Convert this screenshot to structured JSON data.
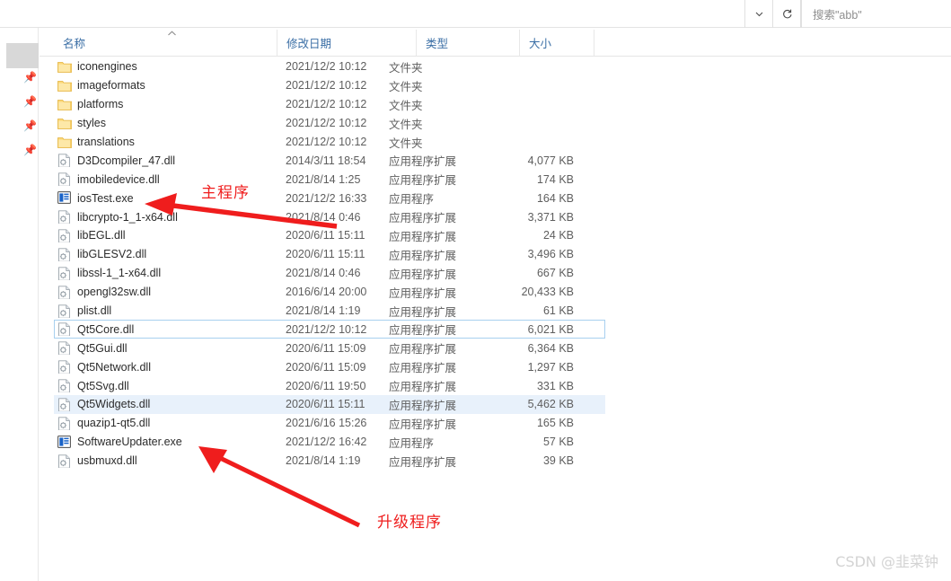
{
  "topbar": {
    "history_dropdown_icon": "chevron-down-icon",
    "refresh_icon": "refresh-icon",
    "search_placeholder": "搜索\"abb\""
  },
  "left_rail": {
    "pin_icon": "pin-icon",
    "pin_count": 4
  },
  "columns": [
    {
      "key": "name",
      "label": "名称",
      "sort": "asc",
      "sort_caret": "⌃"
    },
    {
      "key": "date",
      "label": "修改日期",
      "sort": "none"
    },
    {
      "key": "type",
      "label": "类型",
      "sort": "none"
    },
    {
      "key": "size",
      "label": "大小",
      "sort": "none"
    }
  ],
  "files": [
    {
      "icon": "folder-icon",
      "name": "iconengines",
      "date": "2021/12/2 10:12",
      "type": "文件夹",
      "size": "",
      "state": "normal"
    },
    {
      "icon": "folder-icon",
      "name": "imageformats",
      "date": "2021/12/2 10:12",
      "type": "文件夹",
      "size": "",
      "state": "normal"
    },
    {
      "icon": "folder-icon",
      "name": "platforms",
      "date": "2021/12/2 10:12",
      "type": "文件夹",
      "size": "",
      "state": "normal"
    },
    {
      "icon": "folder-icon",
      "name": "styles",
      "date": "2021/12/2 10:12",
      "type": "文件夹",
      "size": "",
      "state": "normal"
    },
    {
      "icon": "folder-icon",
      "name": "translations",
      "date": "2021/12/2 10:12",
      "type": "文件夹",
      "size": "",
      "state": "normal"
    },
    {
      "icon": "dll-icon",
      "name": "D3Dcompiler_47.dll",
      "date": "2014/3/11 18:54",
      "type": "应用程序扩展",
      "size": "4,077 KB",
      "state": "normal"
    },
    {
      "icon": "dll-icon",
      "name": "imobiledevice.dll",
      "date": "2021/8/14 1:25",
      "type": "应用程序扩展",
      "size": "174 KB",
      "state": "normal"
    },
    {
      "icon": "application-icon",
      "name": "iosTest.exe",
      "date": "2021/12/2 16:33",
      "type": "应用程序",
      "size": "164 KB",
      "state": "normal"
    },
    {
      "icon": "dll-icon",
      "name": "libcrypto-1_1-x64.dll",
      "date": "2021/8/14 0:46",
      "type": "应用程序扩展",
      "size": "3,371 KB",
      "state": "normal"
    },
    {
      "icon": "dll-icon",
      "name": "libEGL.dll",
      "date": "2020/6/11 15:11",
      "type": "应用程序扩展",
      "size": "24 KB",
      "state": "normal"
    },
    {
      "icon": "dll-icon",
      "name": "libGLESV2.dll",
      "date": "2020/6/11 15:11",
      "type": "应用程序扩展",
      "size": "3,496 KB",
      "state": "normal"
    },
    {
      "icon": "dll-icon",
      "name": "libssl-1_1-x64.dll",
      "date": "2021/8/14 0:46",
      "type": "应用程序扩展",
      "size": "667 KB",
      "state": "normal"
    },
    {
      "icon": "dll-icon",
      "name": "opengl32sw.dll",
      "date": "2016/6/14 20:00",
      "type": "应用程序扩展",
      "size": "20,433 KB",
      "state": "normal"
    },
    {
      "icon": "dll-icon",
      "name": "plist.dll",
      "date": "2021/8/14 1:19",
      "type": "应用程序扩展",
      "size": "61 KB",
      "state": "normal"
    },
    {
      "icon": "dll-icon",
      "name": "Qt5Core.dll",
      "date": "2021/12/2 10:12",
      "type": "应用程序扩展",
      "size": "6,021 KB",
      "state": "focus"
    },
    {
      "icon": "dll-icon",
      "name": "Qt5Gui.dll",
      "date": "2020/6/11 15:09",
      "type": "应用程序扩展",
      "size": "6,364 KB",
      "state": "normal"
    },
    {
      "icon": "dll-icon",
      "name": "Qt5Network.dll",
      "date": "2020/6/11 15:09",
      "type": "应用程序扩展",
      "size": "1,297 KB",
      "state": "normal"
    },
    {
      "icon": "dll-icon",
      "name": "Qt5Svg.dll",
      "date": "2020/6/11 19:50",
      "type": "应用程序扩展",
      "size": "331 KB",
      "state": "normal"
    },
    {
      "icon": "dll-icon",
      "name": "Qt5Widgets.dll",
      "date": "2020/6/11 15:11",
      "type": "应用程序扩展",
      "size": "5,462 KB",
      "state": "hover"
    },
    {
      "icon": "dll-icon",
      "name": "quazip1-qt5.dll",
      "date": "2021/6/16 15:26",
      "type": "应用程序扩展",
      "size": "165 KB",
      "state": "normal"
    },
    {
      "icon": "application-icon",
      "name": "SoftwareUpdater.exe",
      "date": "2021/12/2 16:42",
      "type": "应用程序",
      "size": "57 KB",
      "state": "normal"
    },
    {
      "icon": "dll-icon",
      "name": "usbmuxd.dll",
      "date": "2021/8/14 1:19",
      "type": "应用程序扩展",
      "size": "39 KB",
      "state": "normal"
    }
  ],
  "annotations": {
    "color": "#ef1d1d",
    "items": [
      {
        "id": "main-program",
        "label": "主程序",
        "arrow": "arrow-left-icon"
      },
      {
        "id": "updater-program",
        "label": "升级程序",
        "arrow": "arrow-upleft-icon"
      }
    ]
  },
  "watermark": {
    "text": "CSDN @韭菜钟"
  }
}
